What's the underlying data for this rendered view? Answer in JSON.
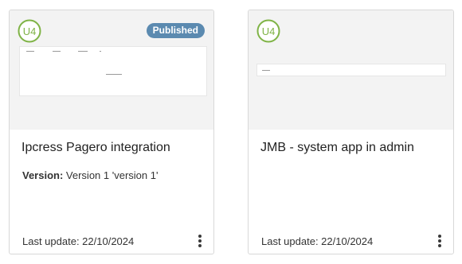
{
  "logo_text": "U4",
  "colors": {
    "logo_green": "#7fb346",
    "badge": "#5b8ab0",
    "preview_bg": "#f3f3f3"
  },
  "icons": {
    "logo": "u4-logo-icon",
    "menu": "more-vertical-icon"
  },
  "cards": [
    {
      "title": "Ipcress Pagero integration",
      "badge": "Published",
      "version_label": "Version:",
      "version_value": "Version 1 'version 1'",
      "last_update": "Last update: 22/10/2024"
    },
    {
      "title": "JMB - system app in admin",
      "last_update": "Last update: 22/10/2024"
    }
  ]
}
